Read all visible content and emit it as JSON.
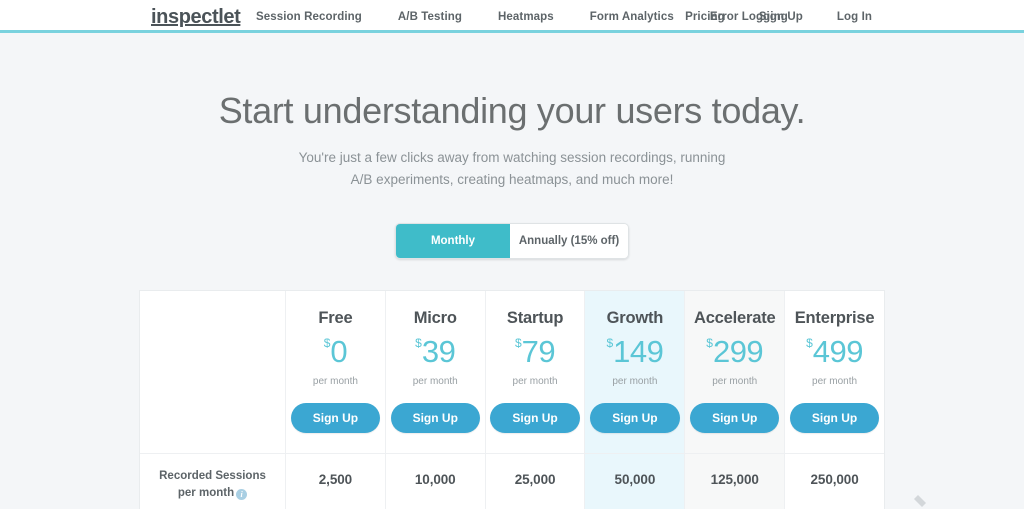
{
  "header": {
    "logo": "inspectlet",
    "nav_left": [
      {
        "label": "Session Recording"
      },
      {
        "label": "A/B Testing"
      },
      {
        "label": "Heatmaps"
      },
      {
        "label": "Form Analytics"
      },
      {
        "label": "Error Logging"
      }
    ],
    "nav_right": [
      {
        "label": "Pricing"
      },
      {
        "label": "Sign Up"
      },
      {
        "label": "Log In"
      }
    ],
    "accent_color": "#79d2de"
  },
  "hero": {
    "title": "Start understanding your users today.",
    "subtitle_line1": "You're just a few clicks away from watching session recordings, running",
    "subtitle_line2": "A/B experiments, creating heatmaps, and much more!"
  },
  "billing_toggle": {
    "monthly_label": "Monthly",
    "annual_label": "Annually (15% off)",
    "selected": "Monthly",
    "active_color": "#3fbcc9"
  },
  "pricing": {
    "currency_symbol": "$",
    "period_label": "per month",
    "signup_label": "Sign Up",
    "signup_color": "#3ba7d2",
    "price_color": "#5bc6d6",
    "highlight_color": "#e9f7fc",
    "plans": [
      {
        "name": "Free",
        "price": "0",
        "period": "per month",
        "cta": "Sign Up",
        "style": "plain"
      },
      {
        "name": "Micro",
        "price": "39",
        "period": "per month",
        "cta": "Sign Up",
        "style": "plain"
      },
      {
        "name": "Startup",
        "price": "79",
        "period": "per month",
        "cta": "Sign Up",
        "style": "plain"
      },
      {
        "name": "Growth",
        "price": "149",
        "period": "per month",
        "cta": "Sign Up",
        "style": "highlight"
      },
      {
        "name": "Accelerate",
        "price": "299",
        "period": "per month",
        "cta": "Sign Up",
        "style": "shade"
      },
      {
        "name": "Enterprise",
        "price": "499",
        "period": "per month",
        "cta": "Sign Up",
        "style": "plain"
      }
    ],
    "features": [
      {
        "name_line1": "Recorded Sessions",
        "name_line2": "per month",
        "has_info_icon": true,
        "info_icon_glyph": "i",
        "values": [
          "2,500",
          "10,000",
          "25,000",
          "50,000",
          "125,000",
          "250,000"
        ]
      }
    ]
  }
}
